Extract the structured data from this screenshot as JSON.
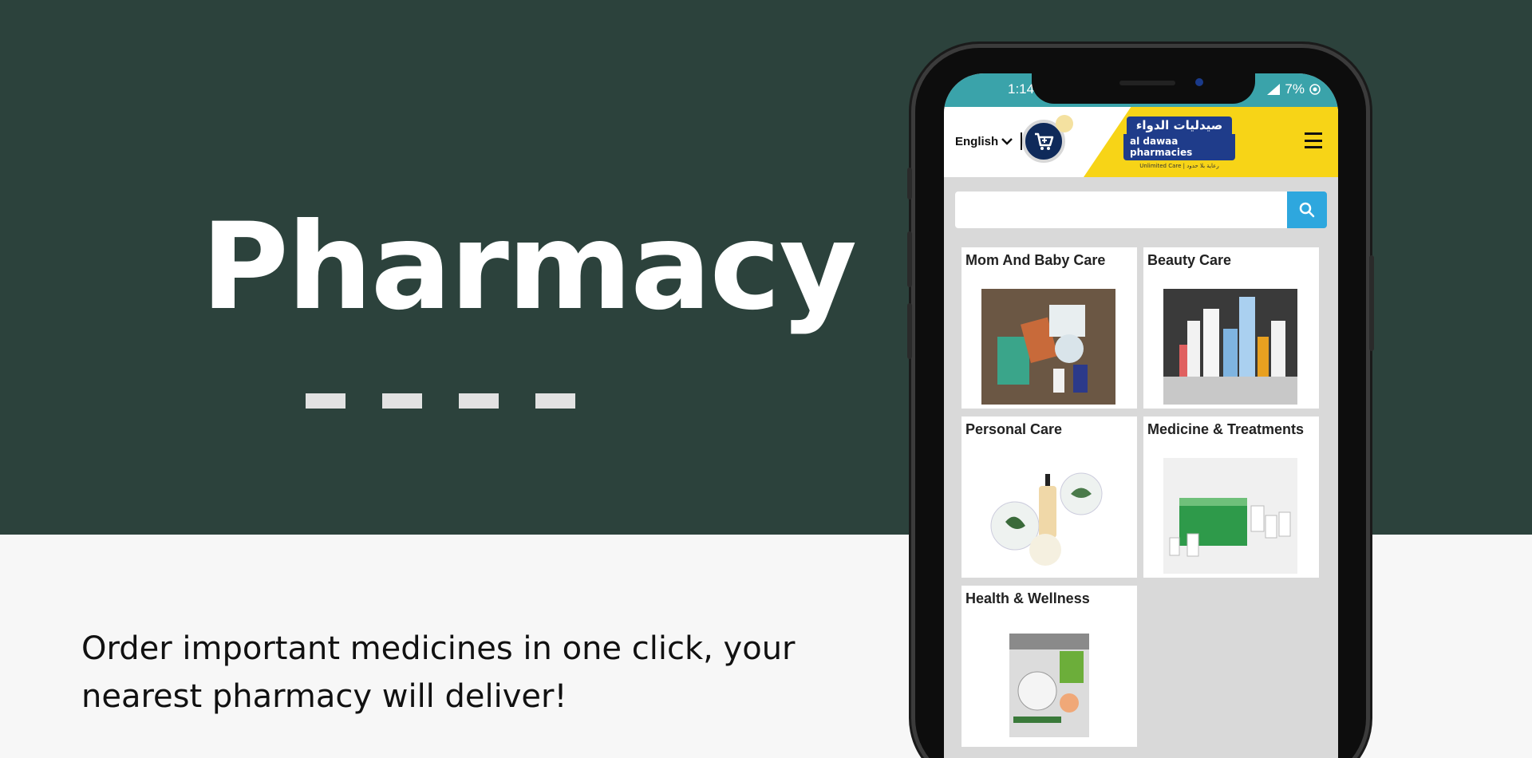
{
  "hero": {
    "title": "Pharmacy",
    "tagline_line1": "Order important medicines in one click, your",
    "tagline_line2": "nearest pharmacy will deliver!"
  },
  "phone": {
    "status": {
      "time": "1:14",
      "battery": "7%"
    },
    "header": {
      "language": "English",
      "logo_arabic": "صيدليات الدواء",
      "logo_english": "al dawaa pharmacies",
      "logo_tagline": "Unlimited Care | رعاية بلا حدود"
    },
    "search": {
      "placeholder": ""
    },
    "categories": [
      {
        "label": "Mom And Baby Care"
      },
      {
        "label": "Beauty Care"
      },
      {
        "label": "Personal Care"
      },
      {
        "label": "Medicine & Treatments"
      },
      {
        "label": "Health & Wellness"
      }
    ]
  },
  "colors": {
    "hero_bg": "#2c423c",
    "status_bar": "#3aa3aa",
    "brand_yellow": "#f7d417",
    "brand_blue": "#1f3c8a",
    "search_button": "#2ea7de"
  }
}
